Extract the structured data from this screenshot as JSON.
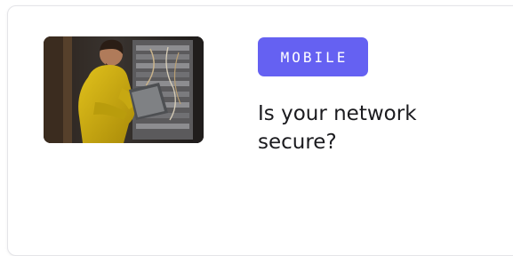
{
  "card": {
    "category_badge": "MOBILE",
    "title": "Is your network secure?",
    "image_icon": "photo-technician-server-rack"
  },
  "colors": {
    "badge_background": "#6561f2",
    "badge_text": "#ffffff",
    "title_text": "#1b1b1f",
    "card_border": "#e4e4e8"
  }
}
